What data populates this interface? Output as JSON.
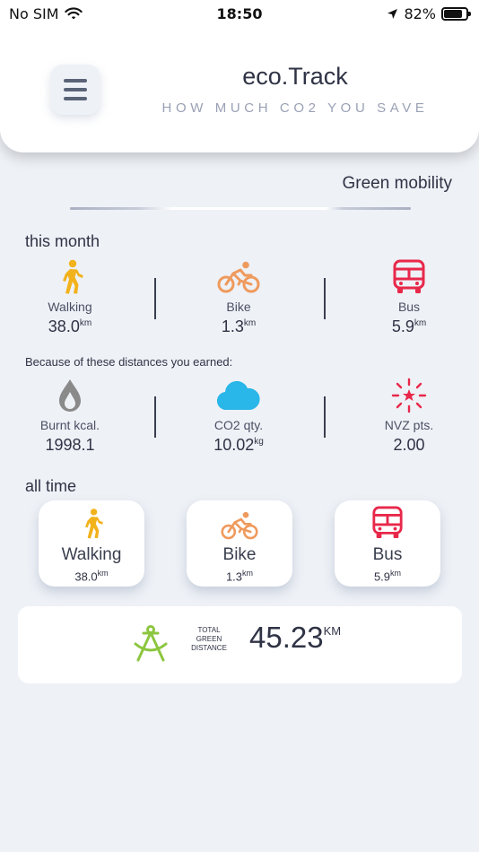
{
  "status_bar": {
    "carrier": "No SIM",
    "time": "18:50",
    "battery": "82%",
    "battery_level": 0.82
  },
  "header": {
    "title": "eco.Track",
    "subtitle": "HOW MUCH CO2 YOU SAVE"
  },
  "section_title": "Green mobility",
  "this_month": {
    "heading": "this month",
    "modes": [
      {
        "label": "Walking",
        "value": "38.0",
        "unit": "km"
      },
      {
        "label": "Bike",
        "value": "1.3",
        "unit": "km"
      },
      {
        "label": "Bus",
        "value": "5.9",
        "unit": "km"
      }
    ],
    "earned_note": "Because of these distances you earned:",
    "earned": [
      {
        "label": "Burnt kcal.",
        "value": "1998.1",
        "unit": ""
      },
      {
        "label": "CO2 qty.",
        "value": "10.02",
        "unit": "kg"
      },
      {
        "label": "NVZ pts.",
        "value": "2.00",
        "unit": ""
      }
    ]
  },
  "all_time": {
    "heading": "all time",
    "modes": [
      {
        "label": "Walking",
        "value": "38.0",
        "unit": "km"
      },
      {
        "label": "Bike",
        "value": "1.3",
        "unit": "km"
      },
      {
        "label": "Bus",
        "value": "5.9",
        "unit": "km"
      }
    ]
  },
  "total": {
    "label": "TOTAL GREEN DISTANCE",
    "value": "45.23",
    "unit": "KM"
  },
  "colors": {
    "walking": "#f2b21b",
    "bike": "#ef9a5d",
    "bus": "#e8284a",
    "burn": "#8a8a8a",
    "co2": "#29b6e8",
    "nvz": "#e8284a",
    "total": "#8cc63f"
  },
  "icons": {
    "walking": "walking-person-icon",
    "bike": "bicycle-icon",
    "bus": "bus-icon",
    "burn": "flame-drop-icon",
    "co2": "cloud-icon",
    "nvz": "sparkle-star-icon",
    "total": "compass-icon"
  }
}
